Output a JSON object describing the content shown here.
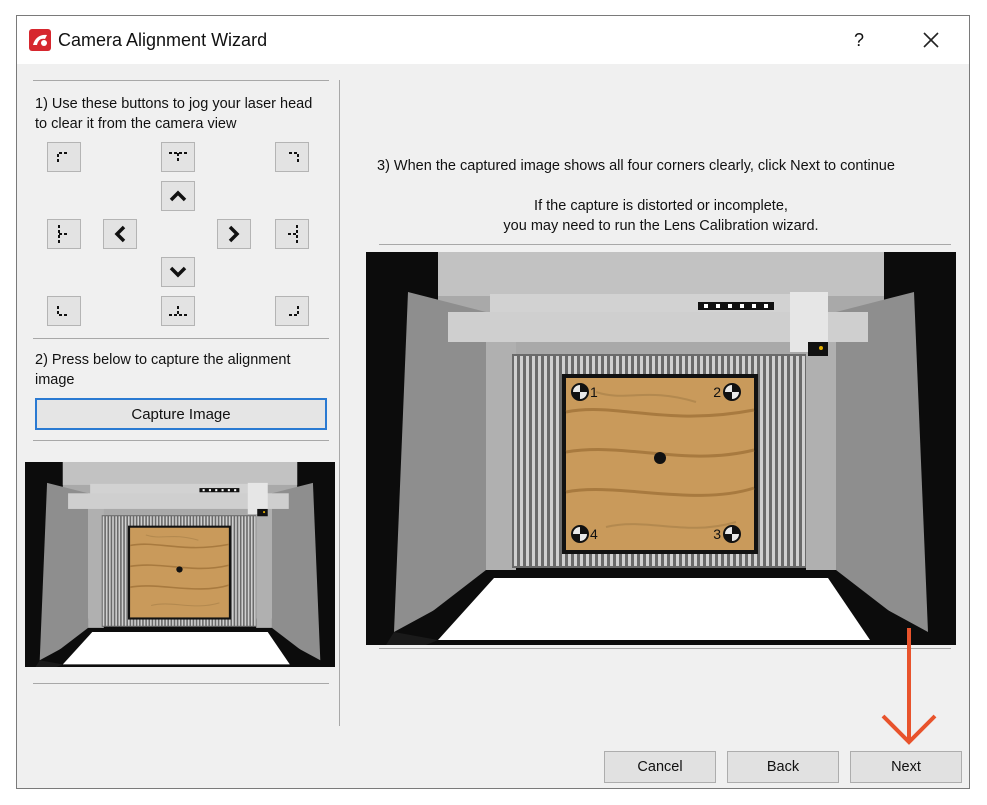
{
  "window": {
    "title": "Camera Alignment Wizard",
    "help_label": "?"
  },
  "steps": {
    "step1": "1) Use these buttons to jog your laser head to clear it from the camera view",
    "step2": "2) Press below to capture the alignment image",
    "step3": "3) When the captured image shows all four corners clearly, click Next to continue",
    "note_line1": "If the capture is distorted or incomplete,",
    "note_line2": "you may need to run the Lens Calibration wizard."
  },
  "capture_button": "Capture Image",
  "buttons": {
    "cancel": "Cancel",
    "back": "Back",
    "next": "Next"
  },
  "marker_labels": {
    "tl": "1",
    "tr": "2",
    "br": "3",
    "bl": "4"
  },
  "jog_buttons": [
    {
      "name": "jog-top-left-button",
      "icon": "corner-top-left-icon"
    },
    {
      "name": "jog-top-center-button",
      "icon": "edge-top-icon"
    },
    {
      "name": "jog-top-right-button",
      "icon": "corner-top-right-icon"
    },
    {
      "name": "jog-up-button",
      "icon": "chevron-up-icon"
    },
    {
      "name": "jog-left-edge-button",
      "icon": "edge-left-icon"
    },
    {
      "name": "jog-left-button",
      "icon": "chevron-left-icon"
    },
    {
      "name": "jog-right-button",
      "icon": "chevron-right-icon"
    },
    {
      "name": "jog-right-edge-button",
      "icon": "edge-right-icon"
    },
    {
      "name": "jog-down-button",
      "icon": "chevron-down-icon"
    },
    {
      "name": "jog-bottom-left-button",
      "icon": "corner-bottom-left-icon"
    },
    {
      "name": "jog-bottom-center-button",
      "icon": "edge-bottom-icon"
    },
    {
      "name": "jog-bottom-right-button",
      "icon": "corner-bottom-right-icon"
    }
  ],
  "colors": {
    "accent_border": "#2a7ad2",
    "annotation_arrow": "#e8532c",
    "wood": "#c99a5b"
  }
}
